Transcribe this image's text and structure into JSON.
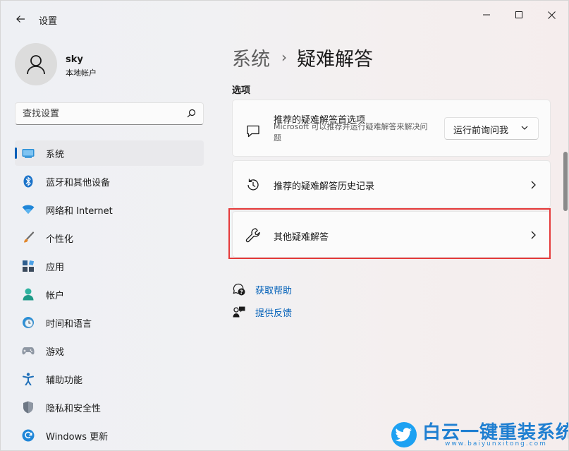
{
  "window": {
    "app_title": "设置",
    "controls": {
      "minimize": "minimize-icon",
      "maximize": "maximize-icon",
      "close": "close-icon"
    }
  },
  "profile": {
    "name": "sky",
    "account_type": "本地帐户"
  },
  "search": {
    "placeholder": "查找设置"
  },
  "sidebar": {
    "items": [
      {
        "label": "系统",
        "icon": "system-icon",
        "active": true
      },
      {
        "label": "蓝牙和其他设备",
        "icon": "bluetooth-icon"
      },
      {
        "label": "网络和 Internet",
        "icon": "wifi-icon"
      },
      {
        "label": "个性化",
        "icon": "brush-icon"
      },
      {
        "label": "应用",
        "icon": "apps-icon"
      },
      {
        "label": "帐户",
        "icon": "account-icon"
      },
      {
        "label": "时间和语言",
        "icon": "clock-globe-icon"
      },
      {
        "label": "游戏",
        "icon": "gamepad-icon"
      },
      {
        "label": "辅助功能",
        "icon": "accessibility-icon"
      },
      {
        "label": "隐私和安全性",
        "icon": "shield-icon"
      },
      {
        "label": "Windows 更新",
        "icon": "update-icon"
      }
    ]
  },
  "main": {
    "breadcrumb": {
      "parent": "系统",
      "separator": "›",
      "current": "疑难解答"
    },
    "section_label": "选项",
    "cards": [
      {
        "title": "推荐的疑难解答首选项",
        "description": "Microsoft 可以推荐并运行疑难解答来解决问题",
        "icon": "chat-bubble-icon",
        "dropdown_value": "运行前询问我"
      },
      {
        "title": "推荐的疑难解答历史记录",
        "icon": "history-icon"
      },
      {
        "title": "其他疑难解答",
        "icon": "wrench-icon",
        "highlighted": true
      }
    ],
    "links": [
      {
        "label": "获取帮助",
        "icon": "help-icon"
      },
      {
        "label": "提供反馈",
        "icon": "feedback-icon"
      }
    ]
  },
  "watermark": {
    "title": "白云一键重装系统",
    "url": "www.baiyunxitong.com"
  },
  "colors": {
    "accent": "#005fb8",
    "highlight_border": "#e53a3a",
    "watermark": "#1f7fd1"
  }
}
